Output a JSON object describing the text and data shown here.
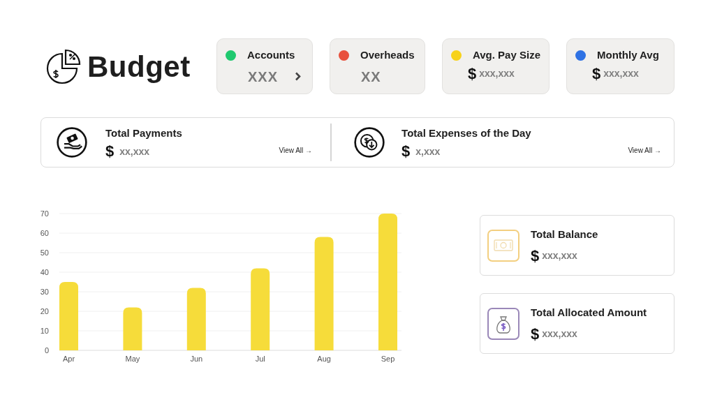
{
  "header": {
    "title": "Budget"
  },
  "stats": [
    {
      "label": "Accounts",
      "color": "#1fc96f",
      "value": "XXX",
      "has_arrow": true
    },
    {
      "label": "Overheads",
      "color": "#e8513d",
      "value": "XX",
      "has_arrow": false
    },
    {
      "label": "Avg. Pay Size",
      "color": "#f7d21a",
      "currency": "$",
      "value": "xxx,xxx",
      "has_arrow": false
    },
    {
      "label": "Monthly Avg",
      "color": "#2f72e4",
      "currency": "$",
      "value": "xxx,xxx",
      "has_arrow": false
    }
  ],
  "summary": [
    {
      "kind": "payments",
      "title": "Total Payments",
      "currency": "$",
      "value": "xx,xxx",
      "link": "View All →"
    },
    {
      "kind": "expenses",
      "title": "Total Expenses of the Day",
      "currency": "$",
      "value": "x,xxx",
      "link": "View All →"
    }
  ],
  "chart": {
    "chart_data": {
      "type": "bar",
      "categories": [
        "Apr",
        "May",
        "Jun",
        "Jul",
        "Aug",
        "Sep"
      ],
      "series": [
        {
          "color": "#f6dc3a",
          "values": [
            35,
            22,
            32,
            42,
            58,
            70
          ]
        }
      ],
      "grid": true,
      "ylim": [
        0,
        70
      ],
      "yticks": [
        0,
        10,
        20,
        30,
        40,
        50,
        60,
        70
      ]
    }
  },
  "balances": [
    {
      "kind": "cash",
      "title": "Total Balance",
      "currency": "$",
      "value": "xxx,xxx"
    },
    {
      "kind": "moneybag",
      "title": "Total Allocated Amount",
      "currency": "$",
      "value": "xxx,xxx"
    }
  ]
}
